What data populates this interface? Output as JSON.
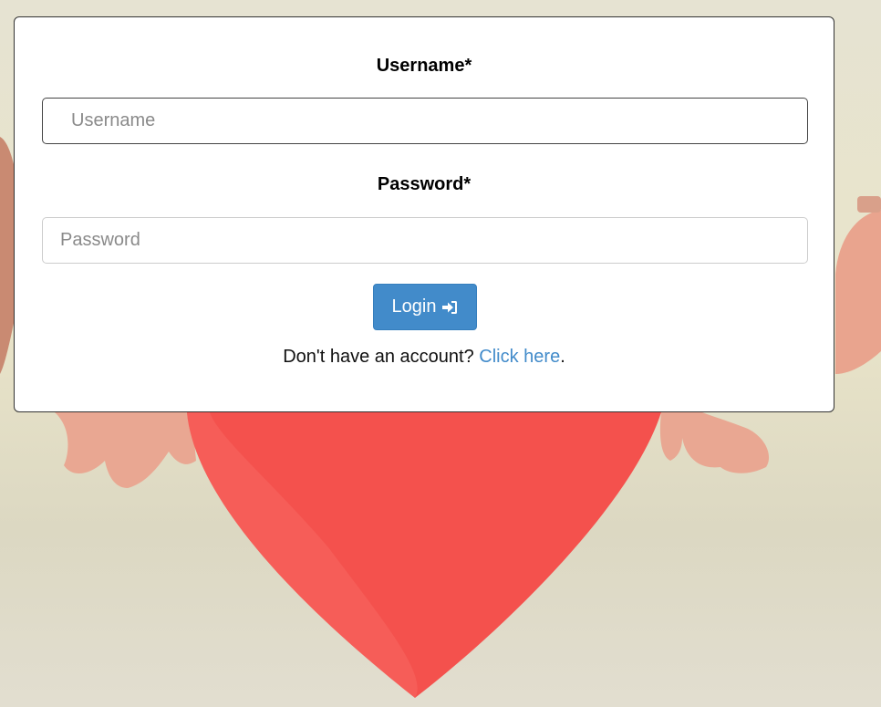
{
  "background": {
    "description_icon": "heart-background-image",
    "heart_color": "#f4514d"
  },
  "form": {
    "username_label": "Username*",
    "username_placeholder": "Username",
    "password_label": "Password*",
    "password_placeholder": "Password",
    "login_label": "Login",
    "login_icon": "sign-in-icon",
    "login_color": "#428bca",
    "signup_prompt": "Don't have an account?",
    "signup_link": "Click here",
    "signup_suffix": "."
  }
}
